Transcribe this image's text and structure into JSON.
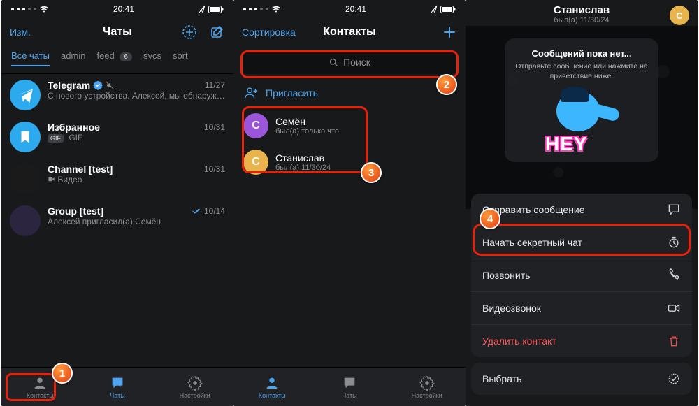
{
  "status": {
    "time": "20:41"
  },
  "phone1": {
    "edit": "Изм.",
    "title": "Чаты",
    "tabs": [
      {
        "label": "Все чаты",
        "active": true
      },
      {
        "label": "admin"
      },
      {
        "label": "feed",
        "badge": "6"
      },
      {
        "label": "svcs"
      },
      {
        "label": "sort"
      }
    ],
    "chats": [
      {
        "name": "Telegram",
        "time": "11/27",
        "msg": "С нового устройства. Алексей, мы обнаружили вход в Ваш аккаунт с нов…",
        "verified": true,
        "muted": true,
        "avatar_bg": "#2da9ee",
        "avatar_letter": ""
      },
      {
        "name": "Избранное",
        "time": "10/31",
        "msg": "GIF",
        "gif": true,
        "avatar_bg": "#2da9ee"
      },
      {
        "name": "Channel [test]",
        "time": "10/31",
        "msg": "Видео",
        "media_icon": true,
        "avatar_bg": "#222"
      },
      {
        "name": "Group [test]",
        "time": "10/14",
        "msg": "Алексей пригласил(а) Семён",
        "checks": true,
        "avatar_bg": "#2b2540"
      }
    ],
    "tabbar": {
      "contacts": "Контакты",
      "chats": "Чаты",
      "settings": "Настройки",
      "active": "chats"
    }
  },
  "phone2": {
    "sort": "Сортировка",
    "title": "Контакты",
    "search_placeholder": "Поиск",
    "invite": "Пригласить",
    "contacts": [
      {
        "name": "Семён",
        "seen": "был(а) только что",
        "letter": "С",
        "bg": "#9a55d9"
      },
      {
        "name": "Станислав",
        "seen": "был(а) 11/30/24",
        "letter": "С",
        "bg": "#e9b44c"
      }
    ],
    "tabbar": {
      "contacts": "Контакты",
      "chats": "Чаты",
      "settings": "Настройки",
      "active": "contacts"
    }
  },
  "phone3": {
    "name": "Станислав",
    "seen": "был(а) 11/30/24",
    "avatar_letter": "С",
    "empty_title": "Сообщений пока нет...",
    "empty_sub": "Отправьте сообщение или нажмите на приветствие ниже.",
    "hey": "HEY",
    "actions": {
      "send": "Отправить сообщение",
      "secret": "Начать секретный чат",
      "call": "Позвонить",
      "video": "Видеозвонок",
      "delete": "Удалить контакт",
      "select": "Выбрать"
    }
  },
  "callouts": {
    "c1": "1",
    "c2": "2",
    "c3": "3",
    "c4": "4"
  }
}
